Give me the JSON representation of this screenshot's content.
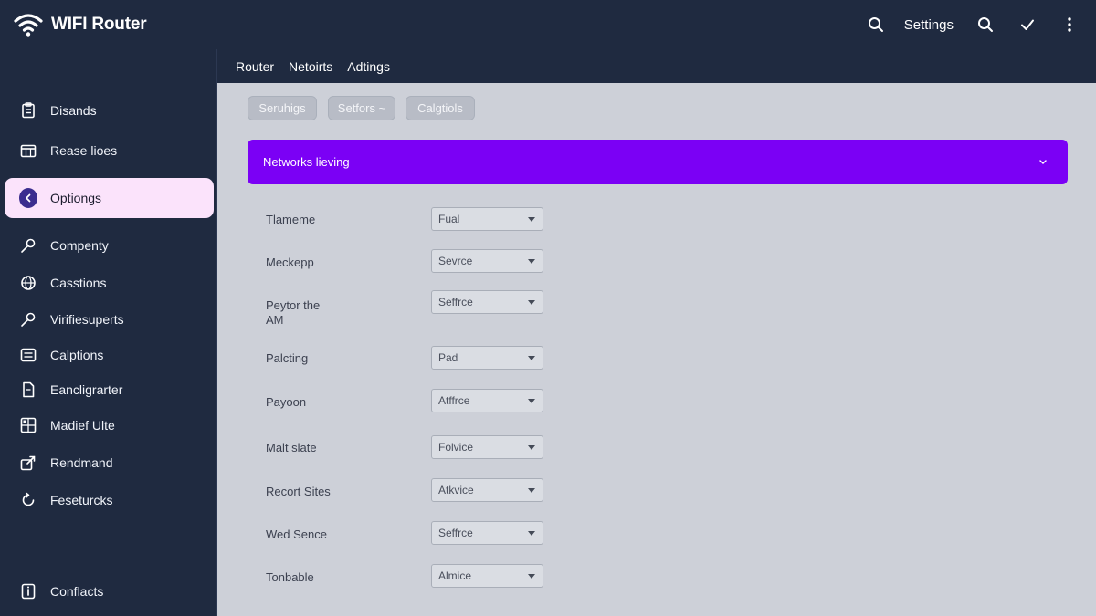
{
  "app": {
    "title": "WIFI Router",
    "wifi_icon": "wifi-icon"
  },
  "topbar": {
    "settings_label": "Settings",
    "icons": [
      "search-icon",
      "search-icon",
      "check-icon",
      "more-vertical-icon"
    ]
  },
  "sidebar": {
    "items": [
      {
        "label": "Disands",
        "icon": "clipboard-icon"
      },
      {
        "label": "Rease lioes",
        "icon": "calendar-icon"
      },
      {
        "label": "Optiongs",
        "icon": "chevron-left-icon",
        "active": true
      },
      {
        "label": "Compenty",
        "icon": "key-icon"
      },
      {
        "label": "Casstions",
        "icon": "globe-icon"
      },
      {
        "label": "Virifiesuperts",
        "icon": "key-icon"
      },
      {
        "label": "Calptions",
        "icon": "list-icon"
      },
      {
        "label": "Eancligrarter",
        "icon": "document-icon"
      },
      {
        "label": "Madief Ulte",
        "icon": "grid-icon"
      },
      {
        "label": "Rendmand",
        "icon": "share-icon"
      },
      {
        "label": "Feseturcks",
        "icon": "refresh-icon"
      },
      {
        "label": "Conflacts",
        "icon": "info-icon"
      }
    ]
  },
  "subnav": {
    "items": [
      "Router",
      "Netoirts",
      "Adtings"
    ]
  },
  "toolbar": {
    "pills": [
      "Seruhigs",
      "Setfors ~",
      "Calgtiols"
    ]
  },
  "banner": {
    "title": "Networks lieving"
  },
  "colors": {
    "sidebar_bg": "#1f2a40",
    "content_bg": "#cdd0d8",
    "banner": "#7b00f5",
    "active_item_bg": "#fbe3fb"
  },
  "form": {
    "rows": [
      {
        "label": "Tlameme",
        "value": "Fual"
      },
      {
        "label": "Meckepp",
        "value": "Sevrce"
      },
      {
        "label": "Peytor the AM",
        "value": "Seffrce"
      },
      {
        "label": "Palcting",
        "value": "Pad"
      },
      {
        "label": "Payoon",
        "value": "Atffrce"
      },
      {
        "label": "Malt slate",
        "value": "Folvice"
      },
      {
        "label": "Recort Sites",
        "value": "Atkvice"
      },
      {
        "label": "Wed Sence",
        "value": "Seffrce"
      },
      {
        "label": "Tonbable",
        "value": "Almice"
      }
    ]
  }
}
